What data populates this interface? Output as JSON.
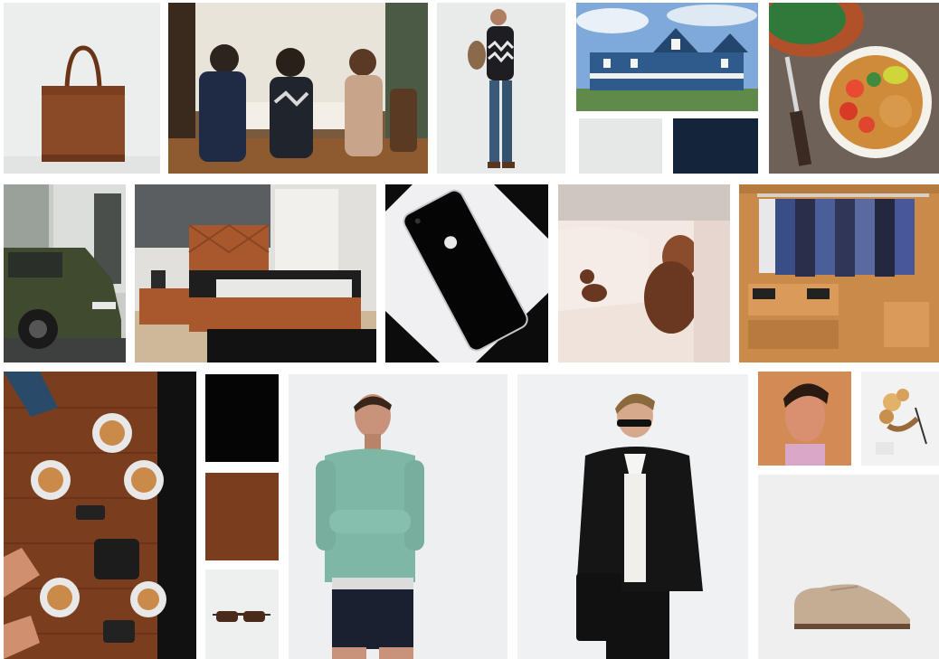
{
  "moodboard": {
    "tiles": [
      {
        "name": "brown-leather-tote-bag-photo"
      },
      {
        "name": "dinner-party-photo"
      },
      {
        "name": "man-patterned-sweater-photo"
      },
      {
        "name": "blue-coastal-house-photo"
      },
      {
        "name": "salad-bowl-photo"
      },
      {
        "name": "green-suv-photo"
      },
      {
        "name": "leather-bed-bedroom-photo"
      },
      {
        "name": "black-smartphone-photo"
      },
      {
        "name": "dogs-on-sofa-photo"
      },
      {
        "name": "clothing-rack-shop-photo"
      },
      {
        "name": "coffee-table-flatlay-photo"
      },
      {
        "name": "man-mint-sweater-photo"
      },
      {
        "name": "man-black-blazer-photo"
      },
      {
        "name": "man-portrait-photo"
      },
      {
        "name": "dried-flowers-photo"
      },
      {
        "name": "sunglasses-photo"
      },
      {
        "name": "suede-shoe-photo"
      }
    ],
    "swatches": [
      {
        "name": "swatch-light-grey",
        "color": "#e6e8e7"
      },
      {
        "name": "swatch-navy",
        "color": "#13243b"
      },
      {
        "name": "swatch-black",
        "color": "#050505"
      },
      {
        "name": "swatch-rust-brown",
        "color": "#7a3e1f"
      }
    ]
  }
}
